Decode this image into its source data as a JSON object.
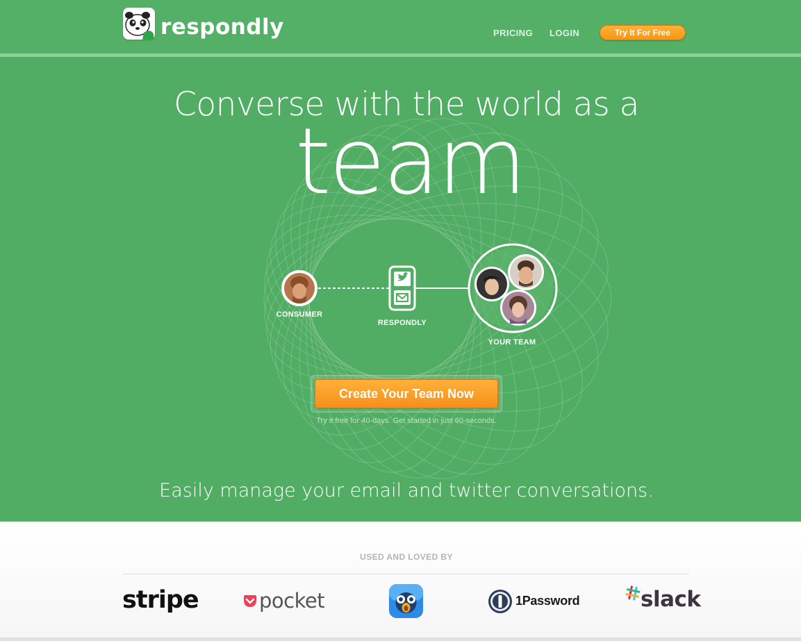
{
  "brand": {
    "name": "respondly",
    "logo_icon": "panda-icon"
  },
  "nav": {
    "pricing": "PRICING",
    "login": "LOGIN",
    "try_button": "Try It For Free"
  },
  "hero": {
    "headline": "Converse with the world as a",
    "headline_big": "team",
    "diagram": {
      "consumer_label": "CONSUMER",
      "respondly_label": "RESPONDLY",
      "team_label": "YOUR TEAM",
      "channel_icons": [
        "twitter-icon",
        "email-icon"
      ]
    },
    "cta_button": "Create Your Team Now",
    "cta_subtext": "Try it free for 40-days. Get started in just 60-seconds.",
    "tagline": "Easily manage your email and twitter conversations."
  },
  "customers": {
    "title": "USED AND LOVED BY",
    "logos": [
      "stripe",
      "pocket",
      "Tweetbot",
      "1Password",
      "slack"
    ]
  },
  "colors": {
    "green": "#52ad64",
    "orange": "#f79615",
    "white": "#ffffff"
  }
}
